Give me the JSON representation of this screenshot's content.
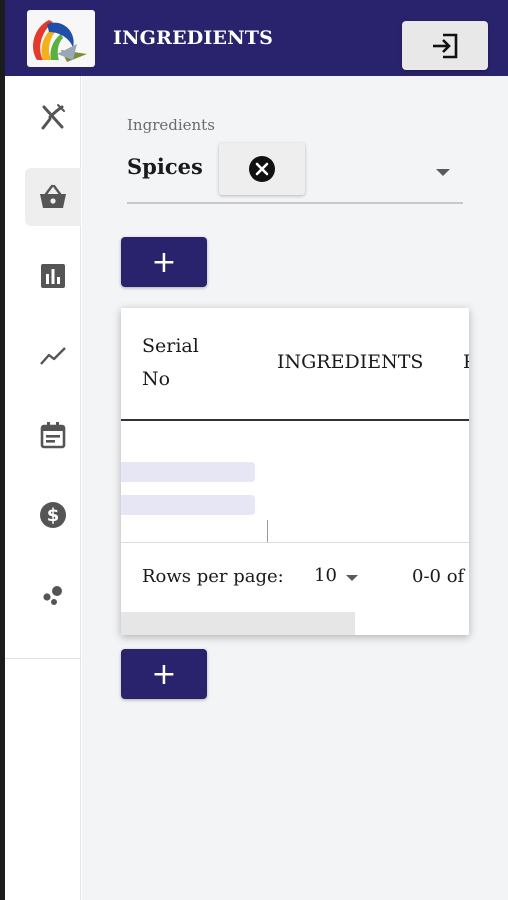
{
  "appbar": {
    "title": "INGREDIENTS",
    "background_color": "#29236e",
    "logout_icon": "logout-icon"
  },
  "sidebar": {
    "items": [
      {
        "name": "menu",
        "icon": "fork-knife-icon",
        "active": false
      },
      {
        "name": "ingredients",
        "icon": "basket-icon",
        "active": true
      },
      {
        "name": "reports",
        "icon": "bar-chart-icon",
        "active": false
      },
      {
        "name": "trends",
        "icon": "trending-line-icon",
        "active": false
      },
      {
        "name": "calendar",
        "icon": "calendar-icon",
        "active": false
      },
      {
        "name": "billing",
        "icon": "dollar-icon",
        "active": false
      },
      {
        "name": "more",
        "icon": "bubbles-icon",
        "active": false
      }
    ]
  },
  "filter": {
    "label": "Ingredients",
    "selected_value": "Spices",
    "clear_icon": "clear-circle-icon",
    "dropdown_icon": "caret-down-icon"
  },
  "buttons": {
    "add_top_label": "+",
    "add_bottom_label": "+",
    "color": "#29236e"
  },
  "table": {
    "columns": [
      "Serial No",
      "INGREDIENTS",
      "P"
    ],
    "rows": [],
    "loading": true,
    "pagination": {
      "rows_per_page_label": "Rows per page:",
      "rows_per_page_value": "10",
      "range_text": "0-0 of"
    }
  }
}
